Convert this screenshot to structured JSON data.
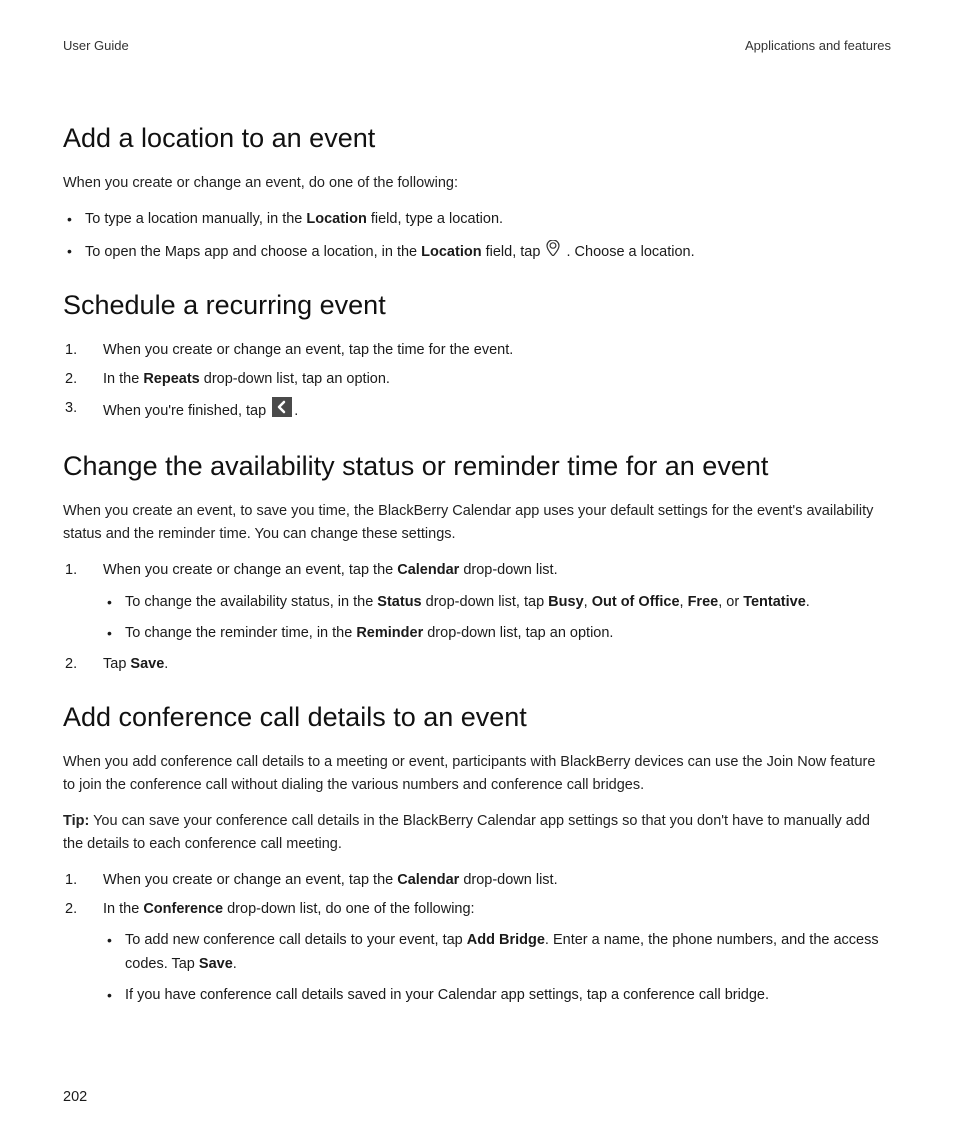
{
  "header": {
    "left": "User Guide",
    "right": "Applications and features"
  },
  "section1": {
    "heading": "Add a location to an event",
    "intro": "When you create or change an event, do one of the following:",
    "bullets": {
      "b1": {
        "pre": "To type a location manually, in the ",
        "bold": "Location",
        "post": " field, type a location."
      },
      "b2": {
        "pre": "To open the Maps app and choose a location, in the ",
        "bold": "Location",
        "mid": " field, tap ",
        "post": " . Choose a location."
      }
    }
  },
  "section2": {
    "heading": "Schedule a recurring event",
    "steps": {
      "s1": "When you create or change an event, tap the time for the event.",
      "s2": {
        "pre": "In the ",
        "bold": "Repeats",
        "post": " drop-down list, tap an option."
      },
      "s3": {
        "pre": "When you're finished, tap ",
        "post": "."
      }
    }
  },
  "section3": {
    "heading": "Change the availability status or reminder time for an event",
    "intro": "When you create an event, to save you time, the BlackBerry Calendar app uses your default settings for the event's availability status and the reminder time. You can change these settings.",
    "step1": {
      "pre": "When you create or change an event, tap the ",
      "bold": "Calendar",
      "post": " drop-down list."
    },
    "sub1": {
      "pre": "To change the availability status, in the ",
      "b1": "Status",
      "mid1": " drop-down list, tap ",
      "b2": "Busy",
      "c1": ", ",
      "b3": "Out of Office",
      "c2": ", ",
      "b4": "Free",
      "c3": ", or ",
      "b5": "Tentative",
      "post": "."
    },
    "sub2": {
      "pre": "To change the reminder time, in the ",
      "bold": "Reminder",
      "post": " drop-down list, tap an option."
    },
    "step2": {
      "pre": "Tap ",
      "bold": "Save",
      "post": "."
    }
  },
  "section4": {
    "heading": "Add conference call details to an event",
    "intro": "When you add conference call details to a meeting or event, participants with BlackBerry devices can use the Join Now feature to join the conference call without dialing the various numbers and conference call bridges.",
    "tip": {
      "label": "Tip:",
      "text": " You can save your conference call details in the BlackBerry Calendar app settings so that you don't have to manually add the details to each conference call meeting."
    },
    "step1": {
      "pre": "When you create or change an event, tap the ",
      "bold": "Calendar",
      "post": " drop-down list."
    },
    "step2": {
      "pre": "In the ",
      "bold": "Conference",
      "post": " drop-down list, do one of the following:"
    },
    "sub1": {
      "pre": "To add new conference call details to your event, tap ",
      "b1": "Add Bridge",
      "mid": ". Enter a name, the phone numbers, and the access codes. Tap ",
      "b2": "Save",
      "post": "."
    },
    "sub2": "If you have conference call details saved in your Calendar app settings, tap a conference call bridge."
  },
  "pageNumber": "202"
}
